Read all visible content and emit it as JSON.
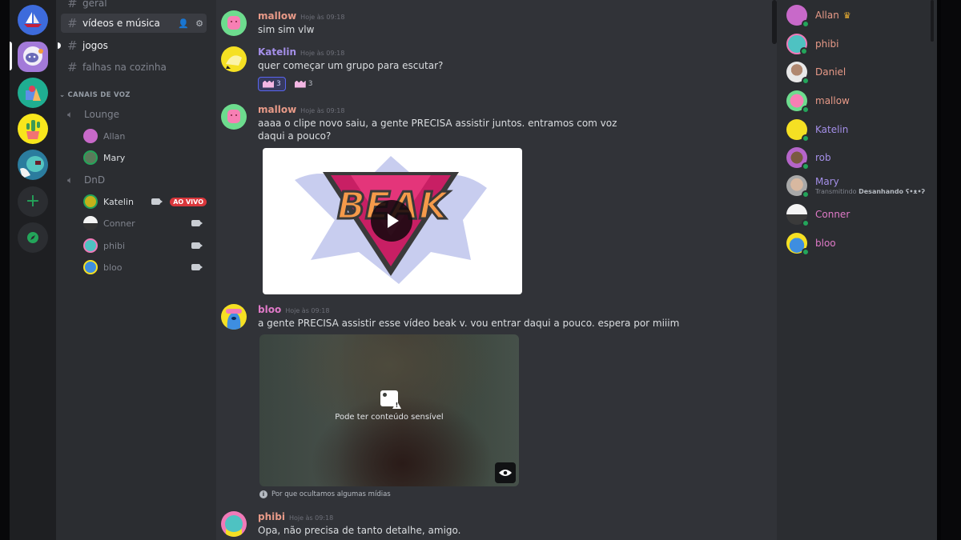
{
  "servers": [
    {
      "name": "sailboat-server",
      "color": "#3d6bdc"
    },
    {
      "name": "astronaut-server",
      "color": "#a37ad9",
      "selected": true
    },
    {
      "name": "shapes-server",
      "color": "#1fae91"
    },
    {
      "name": "cactus-server",
      "color": "#f8e61c"
    },
    {
      "name": "monster-server",
      "color": "#2b7c9e"
    }
  ],
  "rail_actions": {
    "add_server": "+",
    "explore": "compass"
  },
  "channels": {
    "text": [
      {
        "name": "geral",
        "state": "muted"
      },
      {
        "name": "vídeos e música",
        "state": "active"
      },
      {
        "name": "jogos",
        "state": "unread"
      },
      {
        "name": "falhas na cozinha",
        "state": "muted"
      }
    ],
    "voice_category": "CANAIS DE VOZ",
    "voice": [
      {
        "name": "Lounge",
        "users": [
          {
            "name": "Allan",
            "bright": false,
            "color": "#c869c9"
          },
          {
            "name": "Mary",
            "bright": true,
            "color": "#5a7a5a"
          }
        ]
      },
      {
        "name": "DnD",
        "users": [
          {
            "name": "Katelin",
            "bright": true,
            "color": "#c4b21a",
            "camera": true,
            "live": "AO VIVO"
          },
          {
            "name": "Conner",
            "bright": false,
            "color": "#e8e8e8",
            "camera": true
          },
          {
            "name": "phibi",
            "bright": false,
            "color": "#4ec2c2",
            "camera": true
          },
          {
            "name": "bloo",
            "bright": false,
            "color": "#3e8ee0",
            "camera": true
          }
        ]
      }
    ]
  },
  "messages": [
    {
      "author": "mallow",
      "author_color": "#e89a88",
      "time": "Hoje às 09:18",
      "text": "sim sim vlw",
      "avatar_color": "#6ddc8e"
    },
    {
      "author": "Katelin",
      "author_color": "#a48fe8",
      "time": "Hoje às 09:18",
      "text": "quer começar um grupo para escutar?",
      "avatar_color": "#f5e023",
      "reactions": [
        {
          "emoji": "crown-cat",
          "count": "3",
          "mine": true
        },
        {
          "emoji": "crown-cat",
          "count": "3",
          "mine": false
        }
      ]
    },
    {
      "author": "mallow",
      "author_color": "#e89a88",
      "time": "Hoje às 09:18",
      "text": "aaaa o clipe novo saiu, a gente PRECISA assistir juntos. entramos com voz daqui a pouco?",
      "avatar_color": "#6ddc8e",
      "embed": {
        "type": "video",
        "title": "BEAK"
      }
    },
    {
      "author": "bloo",
      "author_color": "#e07ac8",
      "time": "Hoje às 09:18",
      "text": "a gente PRECISA assistir esse vídeo beak v. vou entrar daqui a pouco. espera por miiim",
      "avatar_color": "#f5e023",
      "embed": {
        "type": "sensitive",
        "label": "Pode ter conteúdo sensível",
        "why": "Por que ocultamos algumas mídias"
      }
    },
    {
      "author": "phibi",
      "author_color": "#e89a88",
      "time": "Hoje às 09:18",
      "text": "Opa, não precisa de tanto detalhe, amigo.",
      "avatar_color": "#f07ab8"
    }
  ],
  "members": [
    {
      "name": "Allan",
      "color": "#e89a88",
      "owner": true,
      "avatar_color": "#c869c9"
    },
    {
      "name": "phibi",
      "color": "#e89a88",
      "avatar_color": "#4ec2c2"
    },
    {
      "name": "Daniel",
      "color": "#e89a88",
      "avatar_color": "#d8d8d8"
    },
    {
      "name": "mallow",
      "color": "#e89a88",
      "avatar_color": "#6ddc8e"
    },
    {
      "name": "Katelin",
      "color": "#a48fe8",
      "avatar_color": "#f5e023"
    },
    {
      "name": "rob",
      "color": "#a48fe8",
      "avatar_color": "#b565c9"
    },
    {
      "name": "Mary",
      "color": "#a48fe8",
      "avatar_color": "#c8b8a8",
      "activity_prefix": "Transmitindo",
      "activity": "Desanhando ʕ•ᴥ•ʔ"
    },
    {
      "name": "Conner",
      "color": "#e07ac8",
      "avatar_color": "#eeeeee"
    },
    {
      "name": "bloo",
      "color": "#e07ac8",
      "avatar_color": "#f5e023"
    }
  ]
}
